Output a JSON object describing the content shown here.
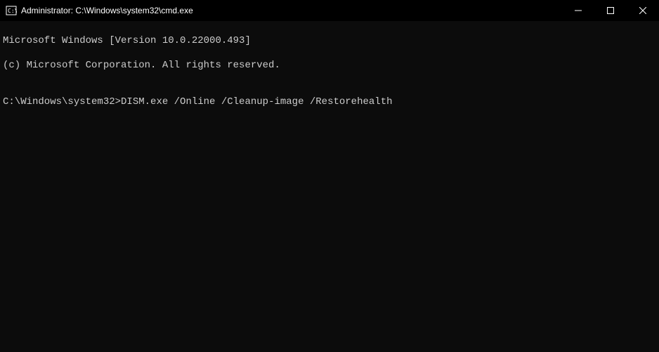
{
  "window": {
    "title": "Administrator: C:\\Windows\\system32\\cmd.exe"
  },
  "terminal": {
    "line1": "Microsoft Windows [Version 10.0.22000.493]",
    "line2": "(c) Microsoft Corporation. All rights reserved.",
    "blank": "",
    "prompt": "C:\\Windows\\system32>",
    "command": "DISM.exe /Online /Cleanup-image /Restorehealth"
  }
}
